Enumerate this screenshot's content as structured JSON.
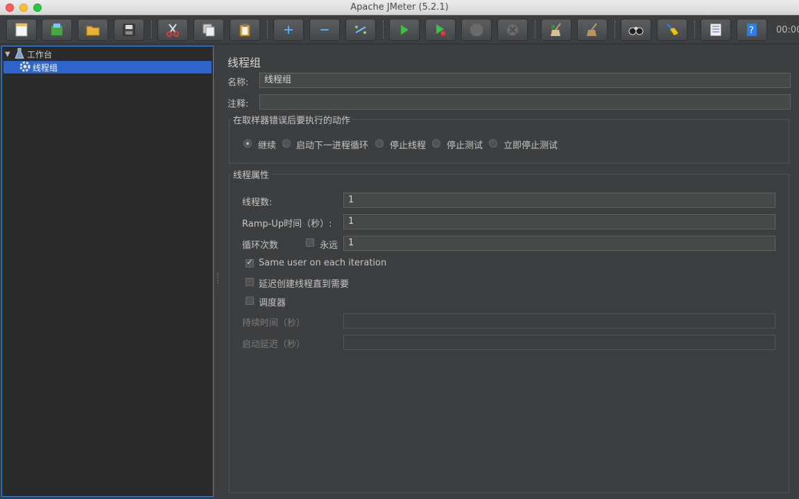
{
  "window": {
    "title": "Apache JMeter (5.2.1)"
  },
  "toolbar": {
    "buttons": [
      {
        "name": "new-button",
        "icon": "new-document-icon"
      },
      {
        "name": "templates-button",
        "icon": "templates-icon"
      },
      {
        "name": "open-button",
        "icon": "open-folder-icon"
      },
      {
        "name": "save-button",
        "icon": "floppy-disk-icon"
      },
      {
        "name": "cut-button",
        "icon": "scissors-icon"
      },
      {
        "name": "copy-button",
        "icon": "copy-icon"
      },
      {
        "name": "paste-button",
        "icon": "clipboard-icon"
      },
      {
        "name": "expand-all-button",
        "icon": "plus-icon"
      },
      {
        "name": "collapse-all-button",
        "icon": "minus-icon"
      },
      {
        "name": "toggle-button",
        "icon": "toggle-icon"
      },
      {
        "name": "start-button",
        "icon": "play-icon"
      },
      {
        "name": "start-no-pauses-button",
        "icon": "play-no-timers-icon"
      },
      {
        "name": "stop-button",
        "icon": "stop-icon"
      },
      {
        "name": "shutdown-button",
        "icon": "shutdown-icon"
      },
      {
        "name": "clear-button",
        "icon": "broom-icon"
      },
      {
        "name": "clear-all-button",
        "icon": "broom-all-icon"
      },
      {
        "name": "search-button",
        "icon": "binoculars-icon"
      },
      {
        "name": "reset-search-button",
        "icon": "eraser-icon"
      },
      {
        "name": "function-helper-button",
        "icon": "list-icon"
      },
      {
        "name": "help-button",
        "icon": "help-icon"
      }
    ],
    "timer": "00:00"
  },
  "tree": {
    "root_label": "工作台",
    "child_label": "线程组"
  },
  "panel": {
    "title": "线程组",
    "name_label": "名称:",
    "name_value": "线程组",
    "comment_label": "注释:",
    "comment_value": "",
    "error_action": {
      "title": "在取样器错误后要执行的动作",
      "options": [
        "继续",
        "启动下一进程循环",
        "停止线程",
        "停止测试",
        "立即停止测试"
      ],
      "selected": "继续"
    },
    "thread_props": {
      "title": "线程属性",
      "threads_label": "线程数:",
      "threads_value": "1",
      "rampup_label": "Ramp-Up时间（秒）:",
      "rampup_value": "1",
      "loop_label": "循环次数",
      "forever_label": "永远",
      "forever_checked": false,
      "loop_value": "1",
      "same_user_label": "Same user on each iteration",
      "same_user_checked": true,
      "delay_label": "延迟创建线程直到需要",
      "delay_checked": false,
      "scheduler_label": "调度器",
      "scheduler_checked": false,
      "duration_label": "持续时间（秒）",
      "duration_value": "",
      "startup_delay_label": "启动延迟（秒）",
      "startup_delay_value": ""
    }
  },
  "colors": {
    "background": "#3c3f41",
    "tree_background": "#2b2b2b",
    "selection": "#2f65ca",
    "play_green": "#3cc23c"
  }
}
